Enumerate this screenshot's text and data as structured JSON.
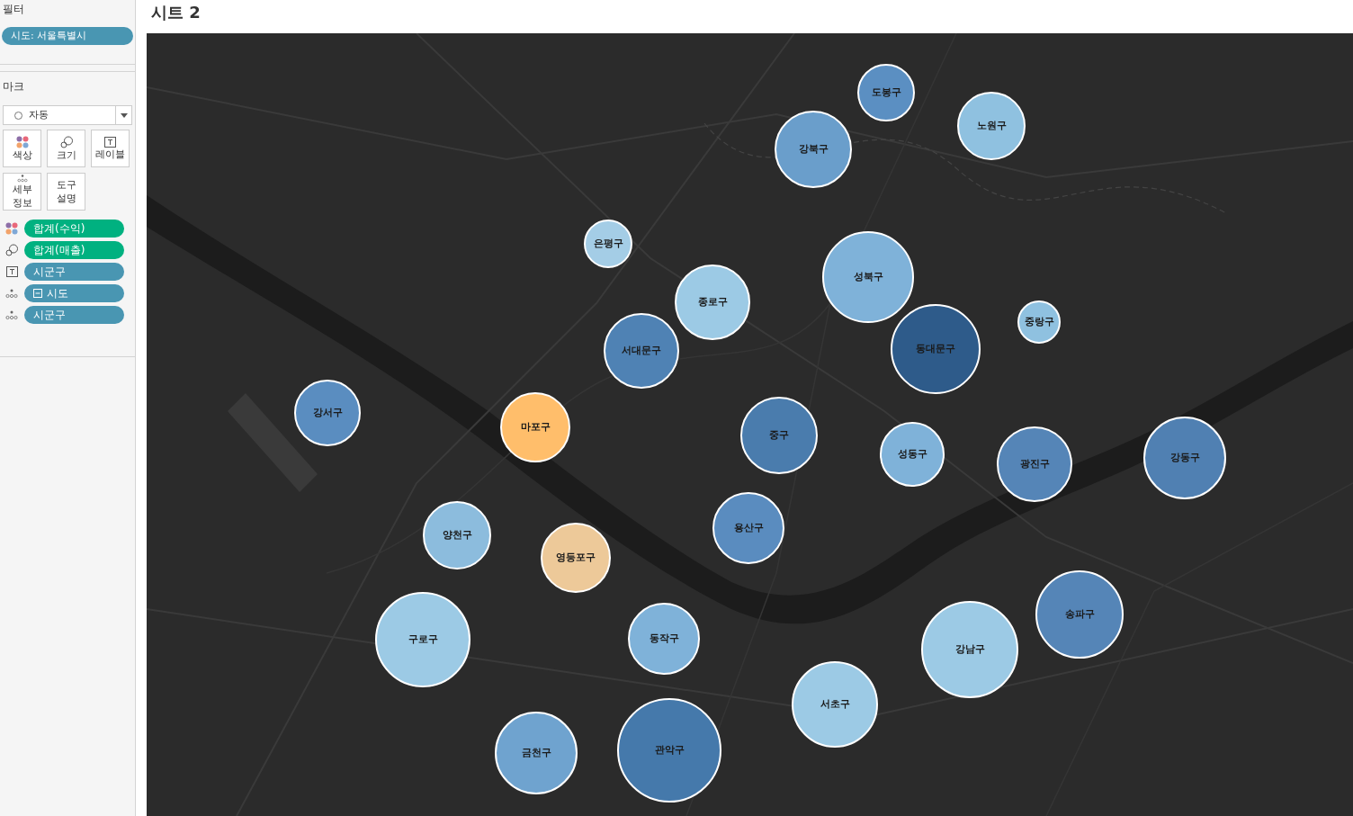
{
  "filters": {
    "title": "필터",
    "pills": [
      {
        "label": "시도: 서울특별시"
      }
    ]
  },
  "marks": {
    "title": "마크",
    "mark_type": "자동",
    "cards": [
      {
        "kind": "color",
        "lines": [
          "색상"
        ]
      },
      {
        "kind": "size",
        "lines": [
          "크기"
        ]
      },
      {
        "kind": "label",
        "lines": [
          "레이블"
        ]
      },
      {
        "kind": "detail",
        "lines": [
          "세부",
          "정보"
        ]
      },
      {
        "kind": "tooltip",
        "lines": [
          "도구",
          "설명"
        ]
      }
    ],
    "fields": [
      {
        "kind": "color",
        "label": "합계(수익)",
        "measure": true,
        "hierarchy": false
      },
      {
        "kind": "size",
        "label": "합계(매출)",
        "measure": true,
        "hierarchy": false
      },
      {
        "kind": "label",
        "label": "시군구",
        "measure": false,
        "hierarchy": false
      },
      {
        "kind": "detail",
        "label": "시도",
        "measure": false,
        "hierarchy": true
      },
      {
        "kind": "detail",
        "label": "시군구",
        "measure": false,
        "hierarchy": false
      }
    ]
  },
  "sheet": {
    "title": "시트 2",
    "map_marks": [
      {
        "label": "도봉구",
        "color": "#5b8fc2"
      },
      {
        "label": "노원구",
        "color": "#8fc1e0"
      },
      {
        "label": "강북구",
        "color": "#6a9ecb"
      },
      {
        "label": "은평구",
        "color": "#a4cde6"
      },
      {
        "label": "성북구",
        "color": "#7fb2d9"
      },
      {
        "label": "종로구",
        "color": "#9ccae5"
      },
      {
        "label": "서대문구",
        "color": "#4f82b4"
      },
      {
        "label": "동대문구",
        "color": "#2e5b8a"
      },
      {
        "label": "중랑구",
        "color": "#8fc1e0"
      },
      {
        "label": "강서구",
        "color": "#5a8dc0"
      },
      {
        "label": "마포구",
        "color": "#ffbe6b"
      },
      {
        "label": "중구",
        "color": "#4a7cad"
      },
      {
        "label": "성동구",
        "color": "#7fb2d9"
      },
      {
        "label": "광진구",
        "color": "#5585b7"
      },
      {
        "label": "강동구",
        "color": "#5080b2"
      },
      {
        "label": "용산구",
        "color": "#5a8cbf"
      },
      {
        "label": "양천구",
        "color": "#8cbcdd"
      },
      {
        "label": "영등포구",
        "color": "#edc999"
      },
      {
        "label": "구로구",
        "color": "#9ccae5"
      },
      {
        "label": "동작구",
        "color": "#7fb2d9"
      },
      {
        "label": "송파구",
        "color": "#5585b7"
      },
      {
        "label": "강남구",
        "color": "#9ccae5"
      },
      {
        "label": "서초구",
        "color": "#9ccae5"
      },
      {
        "label": "금천구",
        "color": "#6fa3cf"
      },
      {
        "label": "관악구",
        "color": "#4579ab"
      }
    ]
  }
}
